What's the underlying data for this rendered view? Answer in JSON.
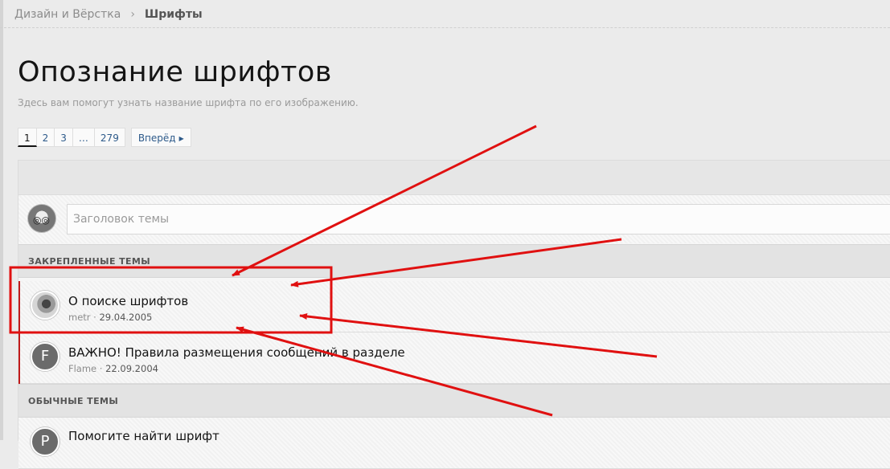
{
  "breadcrumb": {
    "parent": "Дизайн и Вёрстка",
    "current": "Шрифты"
  },
  "page": {
    "title": "Опознание шрифтов",
    "description": "Здесь вам помогут узнать название шрифта по его изображению."
  },
  "pagination": {
    "pages": [
      "1",
      "2",
      "3",
      "…",
      "279"
    ],
    "current": "1",
    "next_label": "Вперёд"
  },
  "new_topic": {
    "placeholder": "Заголовок темы"
  },
  "sections": {
    "sticky": "ЗАКРЕПЛЕННЫЕ ТЕМЫ",
    "normal": "ОБЫЧНЫЕ ТЕМЫ"
  },
  "threads": [
    {
      "title": "О поиске шрифтов",
      "author": "metr",
      "date": "29.04.2005",
      "avatar": "photo"
    },
    {
      "title": "ВАЖНО! Правила размещения сообщений в разделе",
      "author": "Flame",
      "date": "22.09.2004",
      "avatar_letter": "F"
    },
    {
      "title": "Помогите найти шрифт",
      "avatar_letter": "P"
    }
  ],
  "annotation_color": "#e01010"
}
